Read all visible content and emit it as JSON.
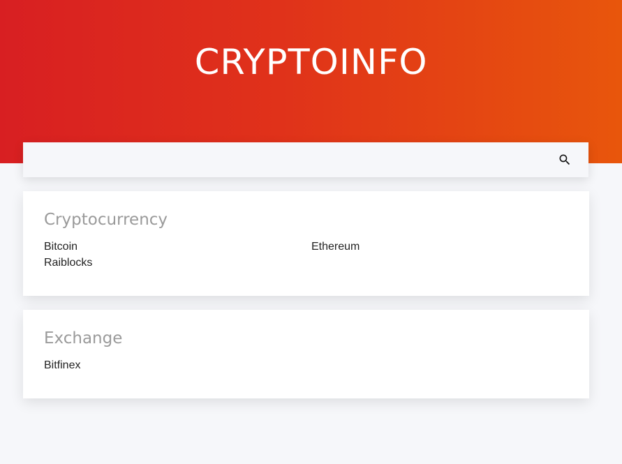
{
  "header": {
    "logo_text": "CRYPTOINFO"
  },
  "search": {
    "value": "",
    "placeholder": "",
    "icon": "search-icon"
  },
  "sections": [
    {
      "title": "Cryptocurrency",
      "items": [
        "Bitcoin",
        "Ethereum",
        "Raiblocks"
      ]
    },
    {
      "title": "Exchange",
      "items": [
        "Bitfinex"
      ]
    }
  ],
  "colors": {
    "hero_gradient_start": "#d81f22",
    "hero_gradient_end": "#e8560c",
    "page_background": "#f6f7fa",
    "card_background": "#ffffff",
    "section_title": "#9a9a9a"
  }
}
